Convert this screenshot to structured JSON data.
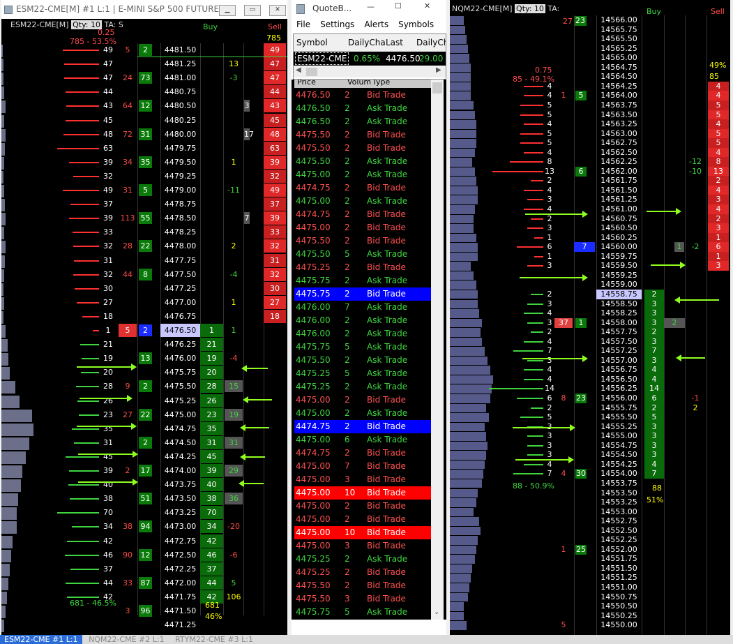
{
  "left": {
    "title": "ESM22-CME[M]  #1 L:1 | E-MINI S&P 500 FUTURES ...",
    "header_symbol": "ESM22-CME[M]",
    "qty_label": "Qty: 10",
    "ta_label": "TA: S",
    "col_buy": "Buy",
    "col_sell": "Sell",
    "top_change": "0.25",
    "top_pct": "785 - 53.5%",
    "sell_total": "785",
    "bottom_pct": "681 - 46.5%",
    "buy_total": "681",
    "buy_pct": "46%",
    "rows": [
      {
        "p": "4481.50",
        "bl": "49",
        "bc": "#ff3030",
        "a": "5",
        "b": "2",
        "s": "49",
        "sc": "red",
        "bw": 0
      },
      {
        "p": "4481.25",
        "bl": "47",
        "bc": "#ff3030",
        "s": "47",
        "n": "13",
        "nc": "yellow",
        "bw": 0
      },
      {
        "p": "4481.00",
        "bl": "47",
        "bc": "#ff3030",
        "a": "24",
        "b": "73",
        "s": "47",
        "n": "-3",
        "nc": "green",
        "bw": 0
      },
      {
        "p": "4480.75",
        "bl": "44",
        "bc": "#ff3030",
        "s": "44",
        "bw": 0
      },
      {
        "p": "4480.50",
        "bl": "43",
        "bc": "#ff3030",
        "a": "64",
        "b": "12",
        "s": "43",
        "g": "3",
        "bw": 0
      },
      {
        "p": "4480.25",
        "bl": "45",
        "bc": "#ff3030",
        "s": "45",
        "bw": 0
      },
      {
        "p": "4480.00",
        "bl": "48",
        "bc": "#ff3030",
        "a": "72",
        "b": "31",
        "s": "48",
        "g": "17",
        "bw": 0
      },
      {
        "p": "4479.75",
        "bl": "63",
        "bc": "#ff3030",
        "s": "63",
        "bw": 0
      },
      {
        "p": "4479.50",
        "bl": "39",
        "bc": "#ff3030",
        "a": "34",
        "b": "35",
        "s": "39",
        "n": "1",
        "nc": "yellow",
        "bw": 0
      },
      {
        "p": "4479.25",
        "bl": "32",
        "bc": "#ff3030",
        "s": "32",
        "bw": 0
      },
      {
        "p": "4479.00",
        "bl": "49",
        "bc": "#ff3030",
        "a": "31",
        "b": "5",
        "s": "49",
        "n": "-11",
        "nc": "green",
        "bw": 0
      },
      {
        "p": "4478.75",
        "bl": "37",
        "bc": "#ff3030",
        "s": "37",
        "bw": 0
      },
      {
        "p": "4478.50",
        "bl": "39",
        "bc": "#ff3030",
        "a": "113",
        "b": "55",
        "s": "39",
        "g": "7",
        "bw": 0
      },
      {
        "p": "4478.25",
        "bl": "33",
        "bc": "#ff3030",
        "s": "33",
        "bw": 0
      },
      {
        "p": "4478.00",
        "bl": "32",
        "bc": "#ff3030",
        "a": "28",
        "b": "22",
        "s": "32",
        "n": "2",
        "nc": "yellow",
        "bw": 0
      },
      {
        "p": "4477.75",
        "bl": "31",
        "bc": "#ff3030",
        "s": "31",
        "bw": 0
      },
      {
        "p": "4477.50",
        "bl": "32",
        "bc": "#ff3030",
        "a": "44",
        "b": "8",
        "s": "32",
        "n": "-4",
        "nc": "green",
        "bw": 0
      },
      {
        "p": "4477.25",
        "bl": "30",
        "bc": "#ff3030",
        "s": "30",
        "bw": 0
      },
      {
        "p": "4477.00",
        "bl": "27",
        "bc": "#ff3030",
        "s": "27",
        "n": "1",
        "nc": "yellow",
        "bw": 0
      },
      {
        "p": "4476.75",
        "bl": "18",
        "bc": "#ff3030",
        "s": "18",
        "bw": 0
      },
      {
        "p": "4476.50",
        "bl": "1",
        "bc": "#ff3030",
        "a": "5",
        "b": "2",
        "cur": true,
        "bv": "1",
        "n": "1",
        "nc": "green",
        "bw": 0
      },
      {
        "p": "4476.25",
        "bl": "21",
        "bc": "#3fd53f",
        "bv": "21",
        "bw": 0
      },
      {
        "p": "4476.00",
        "bl": "19",
        "bc": "#3fd53f",
        "b": "13",
        "bv": "19",
        "n": "-4",
        "nc": "red",
        "bw": 0
      },
      {
        "p": "4475.75",
        "bl": "20",
        "bc": "#3fd53f",
        "bv": "20",
        "bw": 0
      },
      {
        "p": "4475.50",
        "bl": "28",
        "bc": "#3fd53f",
        "a": "9",
        "b": "2",
        "bv": "28",
        "g": "15",
        "bw": 0
      },
      {
        "p": "4475.25",
        "bl": "26",
        "bc": "#3fd53f",
        "bv": "26",
        "bw": 0
      },
      {
        "p": "4475.00",
        "bl": "23",
        "bc": "#3fd53f",
        "a": "27",
        "b": "22",
        "bv": "23",
        "g": "19",
        "bw": 0
      },
      {
        "p": "4474.75",
        "bl": "35",
        "bc": "#3fd53f",
        "bv": "35",
        "bw": 0
      },
      {
        "p": "4474.50",
        "bl": "31",
        "bc": "#3fd53f",
        "b": "2",
        "bv": "31",
        "g": "31",
        "bw": 0
      },
      {
        "p": "4474.25",
        "bl": "45",
        "bc": "#3fd53f",
        "bv": "45",
        "bw": 0
      },
      {
        "p": "4474.00",
        "bl": "39",
        "bc": "#3fd53f",
        "a": "2",
        "b": "17",
        "bv": "39",
        "g": "29",
        "bw": 0
      },
      {
        "p": "4473.75",
        "bl": "40",
        "bc": "#3fd53f",
        "bv": "40",
        "bw": 0
      },
      {
        "p": "4473.50",
        "bl": "38",
        "bc": "#3fd53f",
        "b": "51",
        "bv": "38",
        "g": "36",
        "bw": 0
      },
      {
        "p": "4473.25",
        "bl": "70",
        "bc": "#3fd53f",
        "bv": "70",
        "bw": 0
      },
      {
        "p": "4473.00",
        "bl": "34",
        "bc": "#3fd53f",
        "a": "38",
        "b": "94",
        "bv": "34",
        "n": "-20",
        "nc": "red",
        "bw": 0
      },
      {
        "p": "4472.75",
        "bl": "42",
        "bc": "#3fd53f",
        "bv": "42",
        "bw": 0
      },
      {
        "p": "4472.50",
        "bl": "46",
        "bc": "#3fd53f",
        "a": "90",
        "b": "12",
        "bv": "46",
        "n": "-6",
        "nc": "red",
        "bw": 0
      },
      {
        "p": "4472.25",
        "bl": "37",
        "bc": "#3fd53f",
        "bv": "37",
        "bw": 0
      },
      {
        "p": "4472.00",
        "bl": "44",
        "bc": "#3fd53f",
        "a": "33",
        "b": "87",
        "bv": "44",
        "n": "5",
        "nc": "green",
        "bw": 0
      },
      {
        "p": "4471.75",
        "bl": "42",
        "bc": "#3fd53f",
        "bv": "42",
        "n": "106",
        "nc": "yellow",
        "bw": 0
      },
      {
        "p": "4471.50",
        "bl": "",
        "bc": "#3fd53f",
        "a": "3",
        "b": "96",
        "bw": 0
      },
      {
        "p": "4471.25",
        "bl": "",
        "bc": "#3fd53f",
        "bw": 0
      }
    ]
  },
  "quote": {
    "title": "QuoteB...",
    "menu": [
      "File",
      "Settings",
      "Alerts",
      "Symbols"
    ],
    "headers": [
      "Symbol",
      "DailyChan",
      "Last",
      "DailyCha"
    ],
    "row": {
      "symbol": "ESM22-CME",
      "daily_change": "0.65%",
      "last": "4476.50",
      "daily_cha": "29.00"
    },
    "ts_headers": [
      "Price",
      "Volum",
      "Type"
    ],
    "trades": [
      [
        "4476.50",
        "2",
        "Bid Trade",
        "red"
      ],
      [
        "4476.50",
        "2",
        "Ask Trade",
        "green"
      ],
      [
        "4476.50",
        "2",
        "Ask Trade",
        "green"
      ],
      [
        "4475.50",
        "2",
        "Bid Trade",
        "red"
      ],
      [
        "4475.50",
        "2",
        "Bid Trade",
        "red"
      ],
      [
        "4475.50",
        "2",
        "Ask Trade",
        "green"
      ],
      [
        "4475.00",
        "2",
        "Ask Trade",
        "green"
      ],
      [
        "4474.75",
        "2",
        "Bid Trade",
        "red"
      ],
      [
        "4475.00",
        "2",
        "Ask Trade",
        "green"
      ],
      [
        "4474.75",
        "2",
        "Bid Trade",
        "red"
      ],
      [
        "4475.00",
        "2",
        "Bid Trade",
        "red"
      ],
      [
        "4475.50",
        "2",
        "Bid Trade",
        "red"
      ],
      [
        "4475.50",
        "5",
        "Ask Trade",
        "green"
      ],
      [
        "4475.25",
        "2",
        "Bid Trade",
        "red"
      ],
      [
        "4475.75",
        "2",
        "Ask Trade",
        "green"
      ],
      [
        "4475.75",
        "2",
        "Bid Trade",
        "blue"
      ],
      [
        "4476.00",
        "7",
        "Ask Trade",
        "green"
      ],
      [
        "4476.00",
        "2",
        "Ask Trade",
        "green"
      ],
      [
        "4476.00",
        "2",
        "Ask Trade",
        "green"
      ],
      [
        "4475.75",
        "5",
        "Ask Trade",
        "green"
      ],
      [
        "4475.50",
        "2",
        "Ask Trade",
        "green"
      ],
      [
        "4475.25",
        "5",
        "Ask Trade",
        "green"
      ],
      [
        "4475.25",
        "2",
        "Ask Trade",
        "green"
      ],
      [
        "4475.00",
        "2",
        "Bid Trade",
        "red"
      ],
      [
        "4475.00",
        "2",
        "Ask Trade",
        "green"
      ],
      [
        "4474.75",
        "2",
        "Bid Trade",
        "blue"
      ],
      [
        "4475.00",
        "6",
        "Ask Trade",
        "green"
      ],
      [
        "4474.75",
        "2",
        "Bid Trade",
        "red"
      ],
      [
        "4475.00",
        "7",
        "Bid Trade",
        "red"
      ],
      [
        "4475.00",
        "3",
        "Bid Trade",
        "red"
      ],
      [
        "4475.00",
        "10",
        "Bid Trade",
        "redbg"
      ],
      [
        "4475.00",
        "2",
        "Bid Trade",
        "red"
      ],
      [
        "4475.00",
        "2",
        "Bid Trade",
        "red"
      ],
      [
        "4475.00",
        "10",
        "Bid Trade",
        "redbg"
      ],
      [
        "4475.00",
        "3",
        "Bid Trade",
        "red"
      ],
      [
        "4475.25",
        "2",
        "Ask Trade",
        "green"
      ],
      [
        "4475.25",
        "2",
        "Bid Trade",
        "red"
      ],
      [
        "4475.50",
        "2",
        "Bid Trade",
        "red"
      ],
      [
        "4475.50",
        "3",
        "Bid Trade",
        "red"
      ],
      [
        "4475.75",
        "5",
        "Ask Trade",
        "green"
      ]
    ]
  },
  "right": {
    "header_symbol": "NQM22-CME[M]",
    "qty_label": "Qty: 10",
    "ta_label": "TA:",
    "col_buy": "Buy",
    "col_sell": "Sell",
    "top_change": "0.75",
    "top_pct": "85 - 49.1%",
    "sell_pct": "49%",
    "sell_total": "85",
    "bottom_pct": "88 - 50.9%",
    "buy_total": "88",
    "buy_pct": "51%",
    "top_a": "27",
    "top_b": "23",
    "rows": [
      {
        "p": "14566.00"
      },
      {
        "p": "14565.75"
      },
      {
        "p": "14565.50"
      },
      {
        "p": "14565.25"
      },
      {
        "p": "14565.00"
      },
      {
        "p": "14564.75"
      },
      {
        "p": "14564.50"
      },
      {
        "p": "14564.25",
        "bl": "4",
        "bc": "#ff3030",
        "s": "4"
      },
      {
        "p": "14564.00",
        "bl": "4",
        "bc": "#ff3030",
        "a": "1",
        "b": "5",
        "s": "4"
      },
      {
        "p": "14563.75",
        "bl": "5",
        "bc": "#ff3030",
        "s": "5"
      },
      {
        "p": "14563.50",
        "bl": "5",
        "bc": "#ff3030",
        "s": "5"
      },
      {
        "p": "14563.25",
        "bl": "4",
        "bc": "#ff3030",
        "s": "4"
      },
      {
        "p": "14563.00",
        "bl": "5",
        "bc": "#ff3030",
        "s": "5"
      },
      {
        "p": "14562.75",
        "bl": "5",
        "bc": "#ff3030",
        "s": "5"
      },
      {
        "p": "14562.50",
        "bl": "4",
        "bc": "#ff3030",
        "s": "4"
      },
      {
        "p": "14562.25",
        "bl": "8",
        "bc": "#ff3030",
        "s": "8",
        "n": "-12"
      },
      {
        "p": "14562.00",
        "bl": "13",
        "bc": "#ff3030",
        "b": "6",
        "s": "13",
        "n": "-10"
      },
      {
        "p": "14561.75",
        "bl": "2",
        "bc": "#ff3030",
        "s": "2"
      },
      {
        "p": "14561.50",
        "bl": "4",
        "bc": "#ff3030",
        "s": "4"
      },
      {
        "p": "14561.25",
        "bl": "3",
        "bc": "#ff3030",
        "s": "3"
      },
      {
        "p": "14561.00",
        "bl": "4",
        "bc": "#ff3030",
        "s": "4"
      },
      {
        "p": "14560.75",
        "bl": "2",
        "bc": "#ff3030",
        "s": "2"
      },
      {
        "p": "14560.50",
        "bl": "3",
        "bc": "#ff3030",
        "s": "3"
      },
      {
        "p": "14560.25",
        "bl": "1",
        "bc": "#ff3030",
        "s": "1"
      },
      {
        "p": "14560.00",
        "bl": "6",
        "bc": "#ff3030",
        "bb": "7",
        "s": "6",
        "g": "1",
        "n": "-2"
      },
      {
        "p": "14559.75",
        "bl": "1",
        "bc": "#ff3030",
        "s": "1"
      },
      {
        "p": "14559.50",
        "bl": "3",
        "bc": "#ff3030",
        "s": "3"
      },
      {
        "p": "14559.25"
      },
      {
        "p": "14559.00"
      },
      {
        "p": "14558.75",
        "bl": "2",
        "bc": "#3fd53f",
        "cur": true,
        "bv": "2"
      },
      {
        "p": "14558.50",
        "bl": "3",
        "bc": "#3fd53f",
        "bv": "3"
      },
      {
        "p": "14558.25",
        "bl": "4",
        "bc": "#3fd53f",
        "bv": "3"
      },
      {
        "p": "14558.00",
        "bl": "3",
        "bc": "#3fd53f",
        "a": "37",
        "b": "1",
        "bv": "3",
        "g": "2"
      },
      {
        "p": "14557.75",
        "bl": "2",
        "bc": "#3fd53f",
        "bv": "2"
      },
      {
        "p": "14557.50",
        "bl": "4",
        "bc": "#3fd53f",
        "bv": "3"
      },
      {
        "p": "14557.25",
        "bl": "7",
        "bc": "#3fd53f",
        "bv": "7"
      },
      {
        "p": "14557.00",
        "bl": "3",
        "bc": "#3fd53f",
        "bv": "3"
      },
      {
        "p": "14556.75",
        "bl": "4",
        "bc": "#3fd53f",
        "bv": "4"
      },
      {
        "p": "14556.50",
        "bl": "4",
        "bc": "#3fd53f",
        "bv": "4"
      },
      {
        "p": "14556.25",
        "bl": "14",
        "bc": "#3fd53f",
        "bv": "14"
      },
      {
        "p": "14556.00",
        "bl": "6",
        "bc": "#3fd53f",
        "a": "8",
        "b": "23",
        "bv": "6",
        "n": "-1"
      },
      {
        "p": "14555.75",
        "bl": "2",
        "bc": "#3fd53f",
        "bv": "2",
        "n": "2"
      },
      {
        "p": "14555.50",
        "bl": "5",
        "bc": "#3fd53f",
        "bv": "5"
      },
      {
        "p": "14555.25",
        "bl": "3",
        "bc": "#3fd53f",
        "bv": "3"
      },
      {
        "p": "14555.00",
        "bl": "3",
        "bc": "#3fd53f",
        "bv": "3"
      },
      {
        "p": "14554.75",
        "bl": "3",
        "bc": "#3fd53f",
        "bv": "3"
      },
      {
        "p": "14554.50",
        "bl": "3",
        "bc": "#3fd53f",
        "bv": "3"
      },
      {
        "p": "14554.25",
        "bl": "4",
        "bc": "#3fd53f",
        "bv": "4"
      },
      {
        "p": "14554.00",
        "bl": "7",
        "bc": "#3fd53f",
        "a": "4",
        "b": "30",
        "bv": "7"
      },
      {
        "p": "14553.75"
      },
      {
        "p": "14553.50"
      },
      {
        "p": "14553.25"
      },
      {
        "p": "14553.00"
      },
      {
        "p": "14552.75"
      },
      {
        "p": "14552.50"
      },
      {
        "p": "14552.25"
      },
      {
        "p": "14552.00",
        "a": "1",
        "b": "25"
      },
      {
        "p": "14551.75"
      },
      {
        "p": "14551.50"
      },
      {
        "p": "14551.25"
      },
      {
        "p": "14551.00"
      },
      {
        "p": "14550.75"
      },
      {
        "p": "14550.50"
      },
      {
        "p": "14550.25"
      },
      {
        "p": "14550.00",
        "a": "5"
      }
    ]
  },
  "taskbar": [
    "ESM22-CME  #1 L:1",
    "NQM22-CME  #2 L:1",
    "RTYM22-CME  #3 L:1"
  ]
}
